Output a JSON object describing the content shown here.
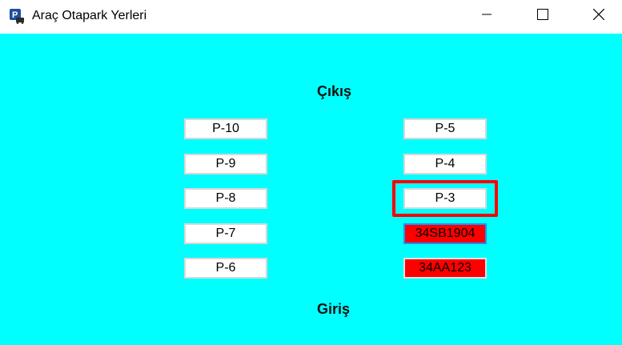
{
  "window": {
    "title": "Araç Otapark Yerleri",
    "icon": "parking-app-icon",
    "controls": [
      "minimize-icon",
      "maximize-icon",
      "close-icon"
    ]
  },
  "colors": {
    "background": "#00ffff",
    "occupied": "#ff0000",
    "empty": "#ffffff",
    "highlight": "#ff0000"
  },
  "labels": {
    "exit": "Çıkış",
    "entry": "Giriş"
  },
  "slots": {
    "left": [
      "P-10",
      "P-9",
      "P-8",
      "P-7",
      "P-6"
    ],
    "right": [
      "P-5",
      "P-4",
      "P-3",
      "34SB1904",
      "34AA123"
    ]
  }
}
